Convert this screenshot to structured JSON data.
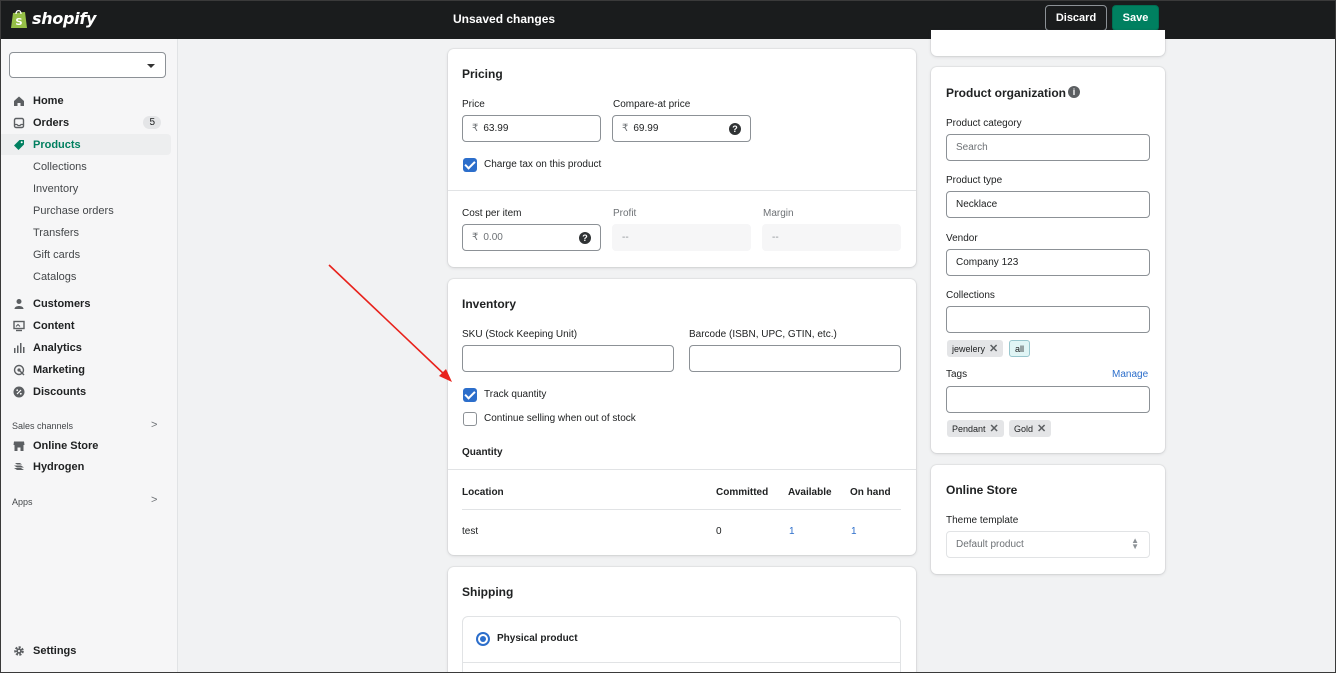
{
  "topbar": {
    "brand": "shopify",
    "status": "Unsaved changes",
    "discard_label": "Discard",
    "save_label": "Save"
  },
  "sidebar": {
    "store_selected": "",
    "items": [
      {
        "label": "Home",
        "icon": "home-icon"
      },
      {
        "label": "Orders",
        "icon": "orders-icon",
        "badge": "5"
      },
      {
        "label": "Products",
        "icon": "tag-icon",
        "active": true
      },
      {
        "label": "Customers",
        "icon": "person-icon"
      },
      {
        "label": "Content",
        "icon": "content-icon"
      },
      {
        "label": "Analytics",
        "icon": "analytics-icon"
      },
      {
        "label": "Marketing",
        "icon": "marketing-icon"
      },
      {
        "label": "Discounts",
        "icon": "discount-icon"
      }
    ],
    "product_subitems": [
      "Collections",
      "Inventory",
      "Purchase orders",
      "Transfers",
      "Gift cards",
      "Catalogs"
    ],
    "sales_channels_label": "Sales channels",
    "channels": [
      {
        "label": "Online Store",
        "icon": "store-icon"
      },
      {
        "label": "Hydrogen",
        "icon": "hydrogen-icon"
      }
    ],
    "apps_label": "Apps",
    "settings_label": "Settings"
  },
  "pricing": {
    "title": "Pricing",
    "price_label": "Price",
    "price_value": "63.99",
    "compare_label": "Compare-at price",
    "compare_value": "69.99",
    "currency": "₹",
    "charge_tax_label": "Charge tax on this product",
    "charge_tax": true,
    "cost_label": "Cost per item",
    "cost_value": "0.00",
    "profit_label": "Profit",
    "profit_value": "--",
    "margin_label": "Margin",
    "margin_value": "--"
  },
  "inventory": {
    "title": "Inventory",
    "sku_label": "SKU (Stock Keeping Unit)",
    "sku_value": "",
    "barcode_label": "Barcode (ISBN, UPC, GTIN, etc.)",
    "barcode_value": "",
    "track_label": "Track quantity",
    "track": true,
    "continue_label": "Continue selling when out of stock",
    "continue": false,
    "quantity_label": "Quantity",
    "columns": [
      "Location",
      "Committed",
      "Available",
      "On hand"
    ],
    "rows": [
      {
        "location": "test",
        "committed": "0",
        "available": "1",
        "on_hand": "1"
      }
    ]
  },
  "shipping": {
    "title": "Shipping",
    "physical_label": "Physical product"
  },
  "organization": {
    "title": "Product organization",
    "category_label": "Product category",
    "category_placeholder": "Search",
    "type_label": "Product type",
    "type_value": "Necklace",
    "vendor_label": "Vendor",
    "vendor_value": "Company 123",
    "collections_label": "Collections",
    "collections_value": "",
    "collection_tags": [
      "jewelery",
      "all"
    ],
    "tags_label": "Tags",
    "manage_label": "Manage",
    "tags_value": "",
    "tags": [
      "Pendant",
      "Gold"
    ]
  },
  "online_store": {
    "title": "Online Store",
    "theme_label": "Theme template",
    "theme_value": "Default product"
  },
  "colors": {
    "accent": "#008060",
    "link": "#2c6ecb",
    "annotation_arrow": "#e8221b"
  }
}
